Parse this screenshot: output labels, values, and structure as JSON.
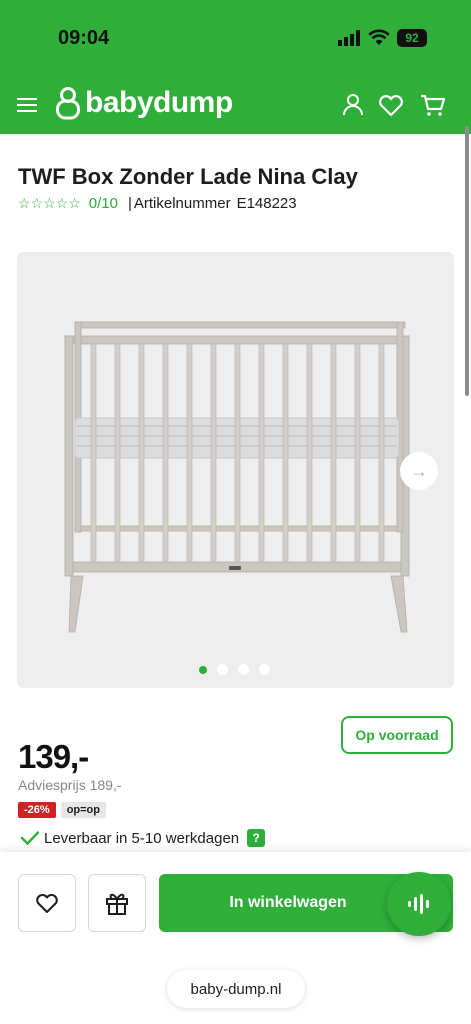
{
  "status_bar": {
    "time": "09:04",
    "battery": "92"
  },
  "header": {
    "brand": "babydump",
    "icons": [
      "hamburger-menu-icon",
      "baby-logo-icon",
      "user-icon",
      "heart-icon",
      "cart-icon"
    ]
  },
  "product": {
    "title": "TWF Box Zonder Lade Nina Clay",
    "stars": "☆☆☆☆☆",
    "rating": "0/10",
    "separator": "|",
    "article_label": "Artikelnummer",
    "article_number": "E148223"
  },
  "gallery": {
    "slide_count": 4,
    "active_slide": 1,
    "next_glyph": "→"
  },
  "stock": "Op voorraad",
  "price": {
    "current": "139,-",
    "advies": "Adviesprijs 189,-",
    "discount_badge": "-26%",
    "op_badge": "op=op"
  },
  "delivery": {
    "text": "Leverbaar in 5-10 werkdagen",
    "help": "?"
  },
  "bottom_bar": {
    "cart_label": "In winkelwagen",
    "url": "baby-dump.nl"
  },
  "colors": {
    "brand_green": "#2fae3a",
    "discount_red": "#d32027"
  }
}
